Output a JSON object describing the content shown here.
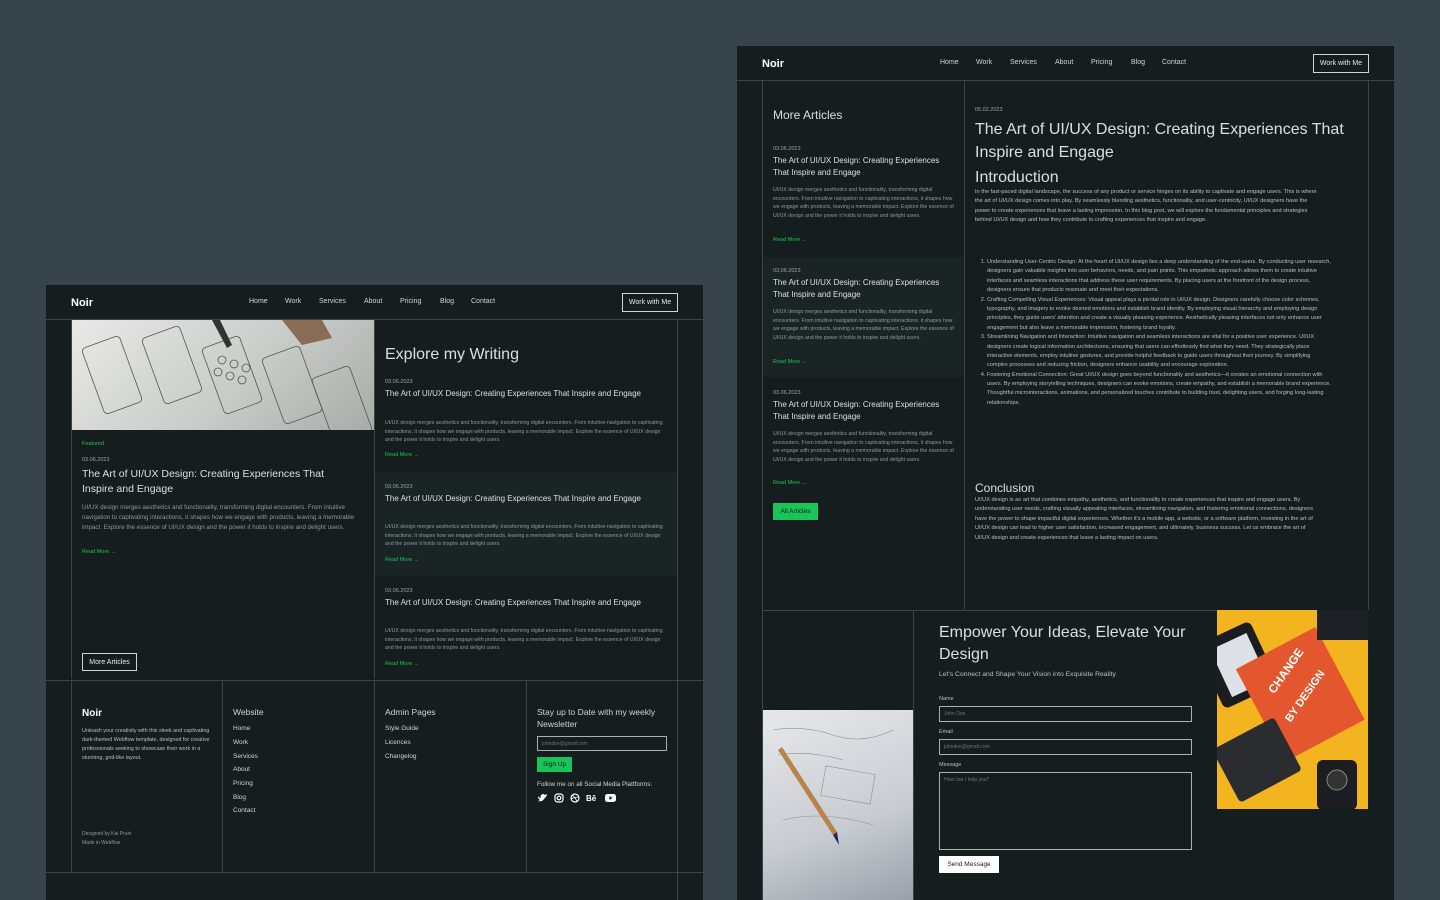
{
  "brand": "Noir",
  "nav": [
    "Home",
    "Work",
    "Services",
    "About",
    "Pricing",
    "Blog",
    "Contact"
  ],
  "cta": "Work with Me",
  "article_date": "03.06.2023",
  "article_title": "The Art of UI/UX Design: Creating Experiences That Inspire and Engage",
  "article_title_short": "The Art of UI/UX Design: Creating Experiences That Inspire and Engage",
  "excerpt": "UI/UX design merges aesthetics and functionality, transforming digital encounters. From intuitive navigation to captivating interactions, it shapes how we engage with products, leaving a memorable impact. Explore the essence of UI/UX design and the power it holds to inspire and delight users.",
  "read_more": "Read More →",
  "home": {
    "featured_label": "Featured",
    "more_articles_btn": "More Articles",
    "section_title": "Explore my Writing"
  },
  "footer": {
    "brand": "Noir",
    "tagline": "Unleash your creativity with this sleek and captivating dark-themed Webflow template, designed for creative professionals seeking to showcase their work in a stunning, grid-like layout.",
    "credit1": "Designed by Kai Pruin",
    "credit2": "Made in Webflow",
    "website_title": "Website",
    "website_links": [
      "Home",
      "Work",
      "Services",
      "About",
      "Pricing",
      "Blog",
      "Contact"
    ],
    "admin_title": "Admin Pages",
    "admin_links": [
      "Style Guide",
      "Licences",
      "Changelog"
    ],
    "newsletter_title": "Stay up to Date with my weekly Newsletter",
    "email_placeholder": "johndoe@gmail.com",
    "signup": "Sign Up",
    "social_label": "Follow me on all Social Media Plattforms:",
    "social_icons": [
      "twitter-icon",
      "instagram-icon",
      "dribbble-icon",
      "behance-icon",
      "youtube-icon"
    ]
  },
  "blog": {
    "more_title": "More Articles",
    "all_articles_btn": "All Articles",
    "post_date": "05.02.2023",
    "post_title": "The Art of UI/UX Design: Creating Experiences That Inspire and Engage",
    "intro_heading": "Introduction",
    "intro_text": "In the fast-paced digital landscape, the success of any product or service hinges on its ability to captivate and engage users. This is where the art of UI/UX design comes into play. By seamlessly blending aesthetics, functionality, and user-centricity, UI/UX designers have the power to create experiences that leave a lasting impression. In this blog post, we will explore the fundamental principles and strategies behind UI/UX design and how they contribute to crafting experiences that inspire and engage.",
    "list": [
      "Understanding User-Centric Design: At the heart of UI/UX design lies a deep understanding of the end-users. By conducting user research, designers gain valuable insights into user behaviors, needs, and pain points. This empathetic approach allows them to create intuitive interfaces and seamless interactions that address these user requirements. By placing users at the forefront of the design process, designers ensure that products resonate and meet their expectations.",
      "Crafting Compelling Visual Experiences: Visual appeal plays a pivotal role in UI/UX design. Designers carefully choose color schemes, typography, and imagery to evoke desired emotions and establish brand identity. By employing visual hierarchy and employing design principles, they guide users' attention and create a visually pleasing experience. Aesthetically pleasing interfaces not only enhance user engagement but also leave a memorable impression, fostering brand loyalty.",
      "Streamlining Navigation and Interaction: Intuitive navigation and seamless interactions are vital for a positive user experience. UI/UX designers create logical information architectures, ensuring that users can effortlessly find what they need. They strategically place interactive elements, employ intuitive gestures, and provide helpful feedback to guide users throughout their journey. By simplifying complex processes and reducing friction, designers enhance usability and encourage exploration.",
      "Fostering Emotional Connection: Great UI/UX design goes beyond functionality and aesthetics—it creates an emotional connection with users. By employing storytelling techniques, designers can evoke emotions, create empathy, and establish a memorable brand experience. Thoughtful microinteractions, animations, and personalized touches contribute to building trust, delighting users, and forging long-lasting relationships."
    ],
    "conclusion_heading": "Conclusion",
    "conclusion_text": "UI/UX design is an art that combines empathy, aesthetics, and functionality to create experiences that inspire and engage users. By understanding user needs, crafting visually appealing interfaces, streamlining navigation, and fostering emotional connections, designers have the power to shape impactful digital experiences. Whether it's a mobile app, a website, or a software platform, investing in the art of UI/UX design can lead to higher user satisfaction, increased engagement, and ultimately, business success. Let us embrace the art of UI/UX design and create experiences that leave a lasting impact on users.",
    "contact_title": "Empower Your Ideas, Elevate Your Design",
    "contact_sub": "Let's Connect and Shape Your Vision into Exquisite Reality",
    "name_label": "Name",
    "name_placeholder": "John Doe",
    "email_label": "Email",
    "email_placeholder": "johndoe@gmail.com",
    "message_label": "Message",
    "message_placeholder": "How can I help you?",
    "send": "Send Message",
    "book_text_1": "CHANGE",
    "book_text_2": "BY DESIGN"
  }
}
